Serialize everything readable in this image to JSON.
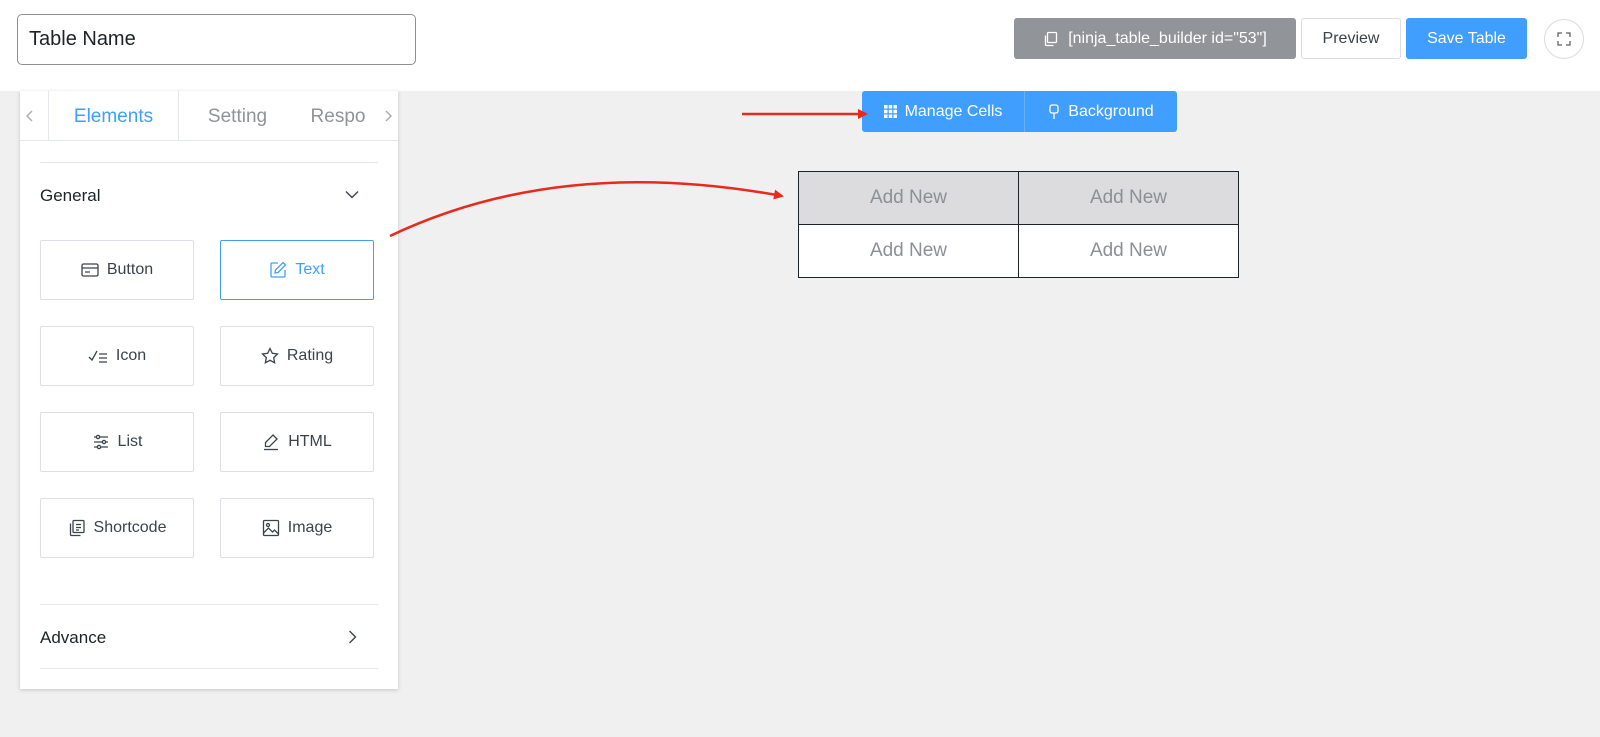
{
  "header": {
    "table_name_value": "Table Name",
    "shortcode_label": "[ninja_table_builder id=\"53\"]",
    "preview_label": "Preview",
    "save_label": "Save Table"
  },
  "sidebar": {
    "tabs": [
      {
        "label": "Elements",
        "active": true
      },
      {
        "label": "Setting",
        "active": false
      },
      {
        "label": "Respo",
        "active": false
      }
    ],
    "general_title": "General",
    "elements": [
      {
        "label": "Button",
        "icon": "card-icon",
        "selected": false
      },
      {
        "label": "Text",
        "icon": "edit-icon",
        "selected": true
      },
      {
        "label": "Icon",
        "icon": "check-list-icon",
        "selected": false
      },
      {
        "label": "Rating",
        "icon": "star-icon",
        "selected": false
      },
      {
        "label": "List",
        "icon": "sliders-icon",
        "selected": false
      },
      {
        "label": "HTML",
        "icon": "pen-icon",
        "selected": false
      },
      {
        "label": "Shortcode",
        "icon": "copy-document-icon",
        "selected": false
      },
      {
        "label": "Image",
        "icon": "image-icon",
        "selected": false
      }
    ],
    "advance_title": "Advance"
  },
  "toolbar": {
    "manage_cells_label": "Manage Cells",
    "background_label": "Background"
  },
  "table": {
    "rows": [
      [
        "Add New",
        "Add New"
      ],
      [
        "Add New",
        "Add New"
      ]
    ]
  },
  "colors": {
    "accent": "#409eff",
    "annotation_arrow": "#e8291c",
    "shortcode_bg": "#919498"
  }
}
